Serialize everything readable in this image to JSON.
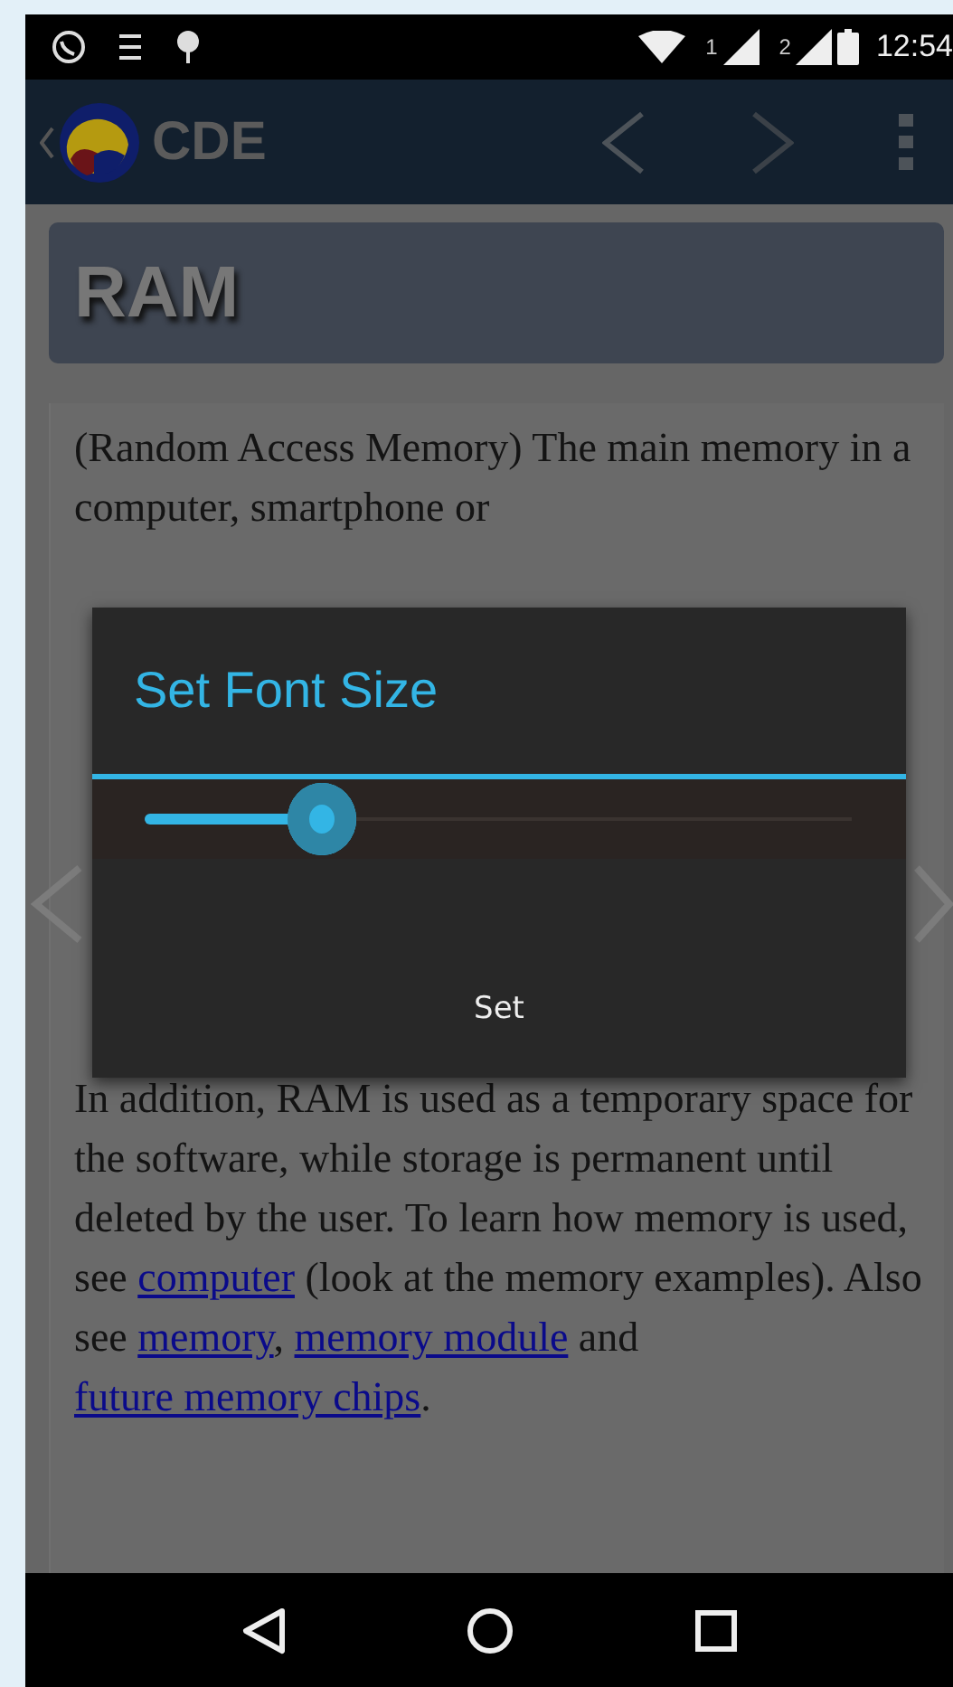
{
  "status_bar": {
    "sim_1": "1",
    "sim_2": "2",
    "time": "12:54"
  },
  "app_bar": {
    "title": "CDE"
  },
  "article": {
    "title": "RAM",
    "intro": "(Random Access Memory) The main memory in a computer, smartphone or",
    "body": [
      {
        "kind": "text",
        "text": "In addition, RAM is used as a temporary space for the software, while storage is permanent until deleted by the user. To learn how memory is used, see "
      },
      {
        "kind": "link",
        "text": "computer"
      },
      {
        "kind": "text",
        "text": " (look at the memory examples). Also see "
      },
      {
        "kind": "link",
        "text": "memory"
      },
      {
        "kind": "text",
        "text": ", "
      },
      {
        "kind": "link",
        "text": "memory module"
      },
      {
        "kind": "text",
        "text": " and "
      },
      {
        "kind": "link",
        "text": "future memory chips"
      },
      {
        "kind": "text",
        "text": "."
      }
    ]
  },
  "dialog": {
    "title": "Set Font Size",
    "slider": {
      "level": 0.25
    },
    "button": "Set"
  }
}
